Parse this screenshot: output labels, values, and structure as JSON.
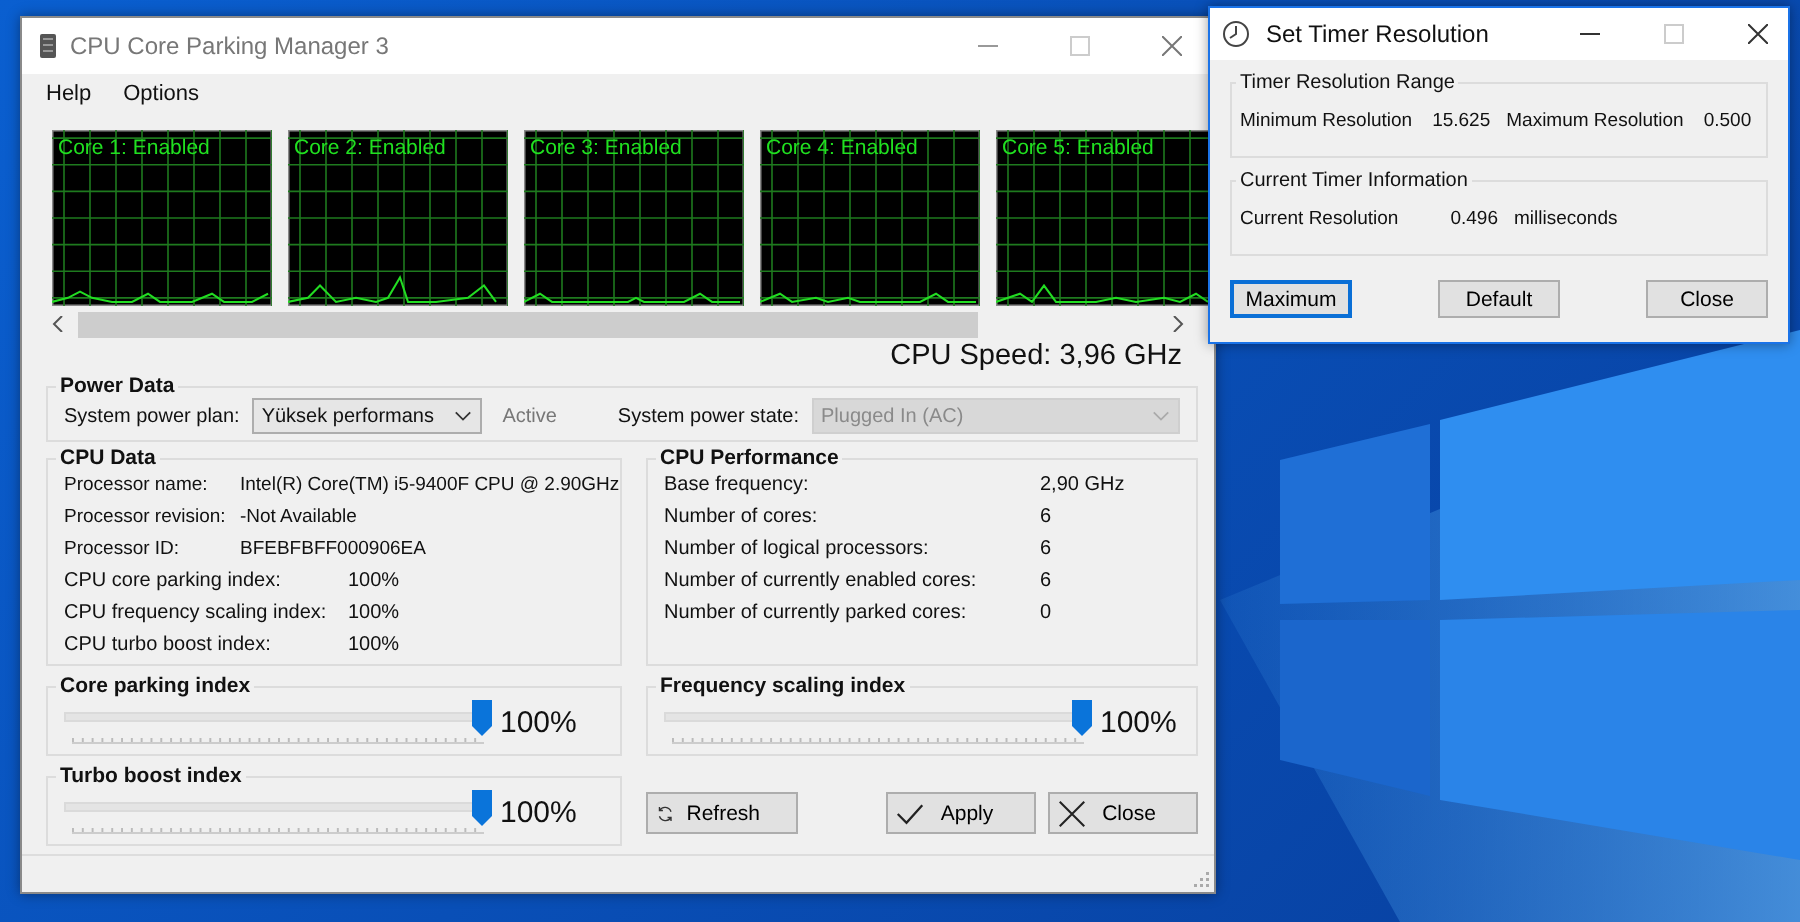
{
  "main_window": {
    "title": "CPU Core Parking Manager 3",
    "menu": [
      "Help",
      "Options"
    ],
    "cores": [
      {
        "label": "Core 1: Enabled"
      },
      {
        "label": "Core 2: Enabled"
      },
      {
        "label": "Core 3: Enabled"
      },
      {
        "label": "Core 4: Enabled"
      },
      {
        "label": "Core 5: Enabled"
      }
    ],
    "cpu_speed": "CPU Speed: 3,96 GHz",
    "power_data": {
      "title": "Power Data",
      "plan_label": "System power plan:",
      "plan_value": "Yüksek performans",
      "plan_status": "Active",
      "state_label": "System power state:",
      "state_value": "Plugged In (AC)",
      "state_disabled": true
    },
    "cpu_data": {
      "title": "CPU Data",
      "info_rows": [
        {
          "label": "Processor name:",
          "value": "Intel(R) Core(TM) i5-9400F CPU @ 2.90GHz"
        },
        {
          "label": "Processor revision:",
          "value": "-Not Available"
        },
        {
          "label": "Processor ID:",
          "value": "BFEBFBFF000906EA"
        }
      ],
      "index_rows": [
        {
          "label": "CPU core parking index:",
          "value": "100%"
        },
        {
          "label": "CPU frequency scaling index:",
          "value": "100%"
        },
        {
          "label": "CPU turbo boost index:",
          "value": "100%"
        }
      ]
    },
    "cpu_performance": {
      "title": "CPU Performance",
      "rows": [
        {
          "label": "Base frequency:",
          "value": "2,90 GHz"
        },
        {
          "label": "Number of cores:",
          "value": "6"
        },
        {
          "label": "Number of logical processors:",
          "value": "6"
        },
        {
          "label": "Number of currently enabled cores:",
          "value": "6"
        },
        {
          "label": "Number of currently parked cores:",
          "value": "0"
        }
      ]
    },
    "sliders": [
      {
        "label": "Core parking index",
        "level": 1,
        "reading": "100%"
      },
      {
        "label": "Frequency scaling index",
        "level": 1,
        "reading": "100%"
      },
      {
        "label": "Turbo boost index",
        "level": 1,
        "reading": "100%"
      }
    ],
    "buttons": [
      {
        "label": "Refresh",
        "kind": "refresh"
      },
      {
        "label": "Apply",
        "kind": "apply"
      },
      {
        "label": "Close",
        "kind": "close"
      }
    ]
  },
  "timer_window": {
    "title": "Set Timer Resolution",
    "range": {
      "title": "Timer Resolution Range",
      "min_label": "Minimum Resolution",
      "min_value": "15.625",
      "max_label": "Maximum Resolution",
      "max_value": "0.500"
    },
    "current": {
      "title": "Current Timer Information",
      "label": "Current Resolution",
      "value": "0.496",
      "unit": "milliseconds"
    },
    "buttons": [
      {
        "label": "Maximum",
        "focused": true
      },
      {
        "label": "Default",
        "focused": false
      },
      {
        "label": "Close",
        "focused": false
      }
    ]
  }
}
